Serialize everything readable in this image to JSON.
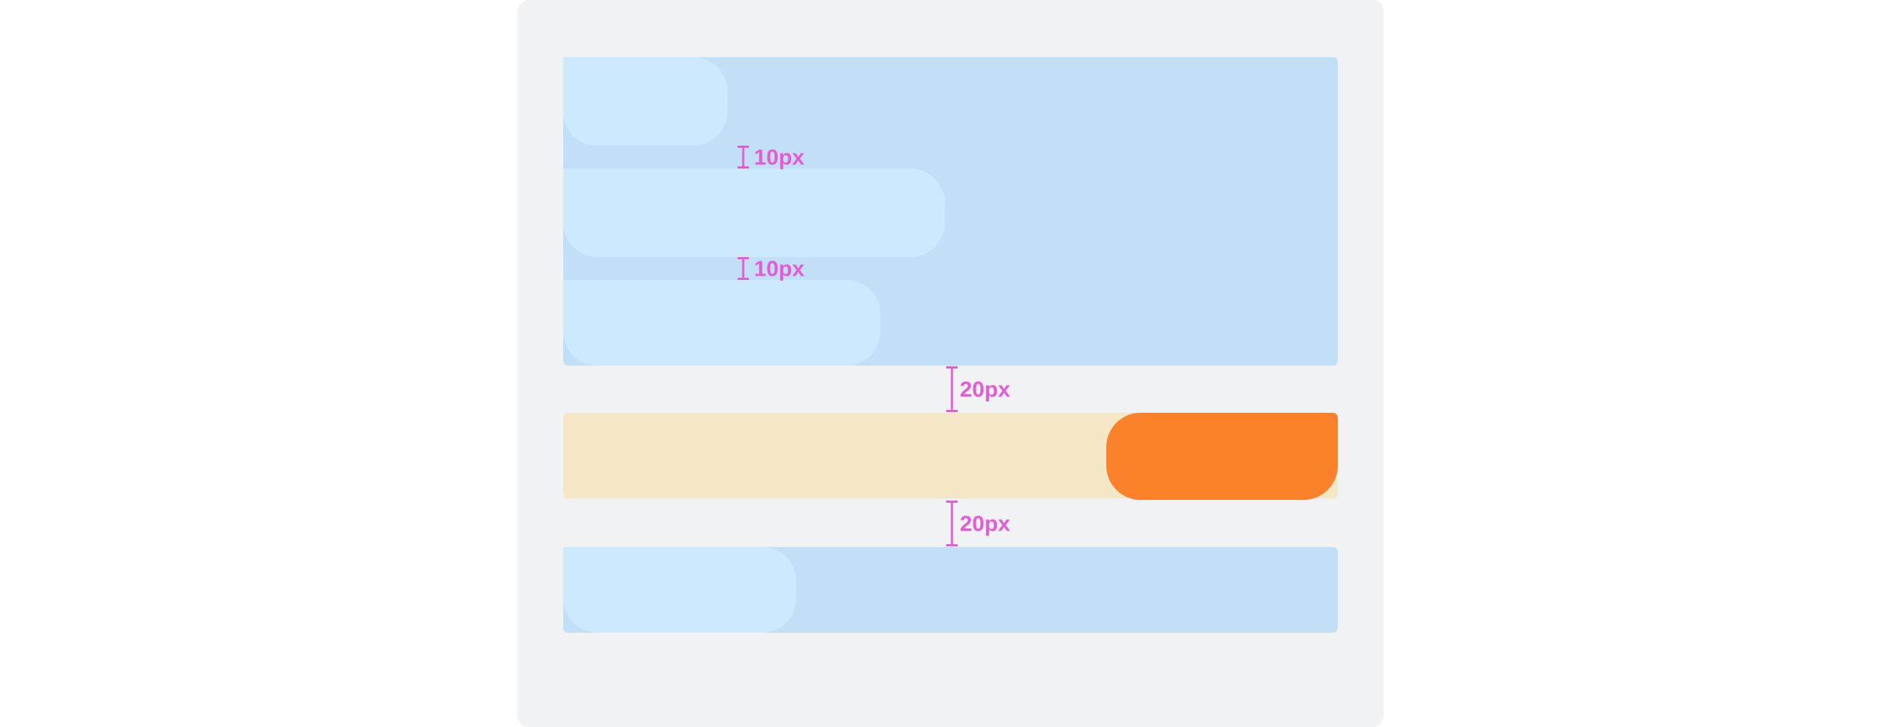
{
  "colors": {
    "canvas": "#ffffff",
    "panel": "#f1f2f4",
    "container_blue": "#c2e0f5",
    "container_sand": "#f3e7c5",
    "bubble_light_blue": "#cde9fd",
    "bubble_orange": "#fb812a",
    "annotation": "#e55bd7"
  },
  "annotations": {
    "gap_small_1": "10px",
    "gap_small_2": "10px",
    "gap_large_1": "20px",
    "gap_large_2": "20px"
  }
}
